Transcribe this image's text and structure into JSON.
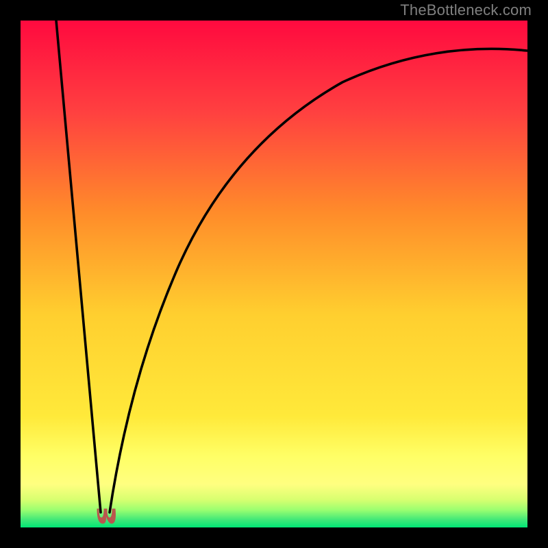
{
  "watermark": {
    "text": "TheBottleneck.com"
  },
  "colors": {
    "black": "#000000",
    "top": "#ff0a3f",
    "orange": "#ff8c2a",
    "yellow": "#ffe43a",
    "yellow_plateau": "#ffff66",
    "near_bottom": "#ccff66",
    "bottom": "#00e676",
    "curve_stroke": "#000000",
    "nub": "#b9564e"
  },
  "chart_data": {
    "type": "line",
    "title": "",
    "xlabel": "",
    "ylabel": "",
    "xlim": [
      0,
      100
    ],
    "ylim": [
      0,
      100
    ],
    "series": [
      {
        "name": "left-branch",
        "x": [
          7,
          8,
          9,
          10,
          11,
          12,
          13,
          14,
          15,
          15.8
        ],
        "values": [
          100,
          89,
          78,
          66,
          55,
          44,
          33,
          22,
          11,
          3
        ]
      },
      {
        "name": "right-branch",
        "x": [
          17.6,
          19,
          21,
          24,
          28,
          33,
          39,
          46,
          54,
          63,
          73,
          84,
          96,
          100
        ],
        "values": [
          3,
          10,
          19,
          30,
          41,
          51,
          60,
          68,
          75,
          81,
          86,
          90,
          93,
          94
        ]
      }
    ],
    "annotations": [
      {
        "name": "minimum-nub",
        "x": 16.7,
        "y": 2
      }
    ]
  }
}
